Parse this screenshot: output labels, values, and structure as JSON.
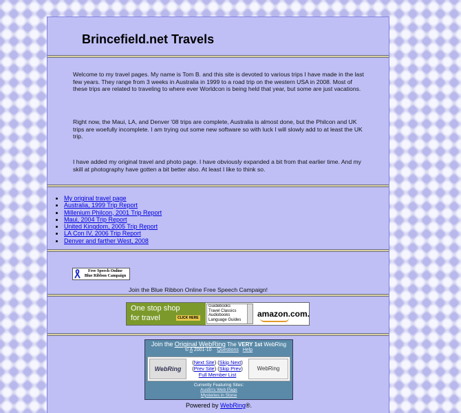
{
  "title": "Brincefield.net Travels",
  "intro": {
    "p1": "Welcome to my travel pages. My name is Tom B. and this site is devoted to various trips I have made in the last few years. They range from 3 weeks in Australia in 1999 to a road trip on the western USA in 2008. Most of these trips are related to traveling to where ever Worldcon is being held that year, but some are just vacations.",
    "p2": "Right now, the Maui, LA, and Denver '08 trips are complete, Australia is almost done, but the Philcon and UK trips are woefully incomplete. I am trying out some new software so with luck I will slowly add to at least the UK trip.",
    "p3": "I have added my original travel and photo page. I have obviously expanded a bit from that earlier time. And my skill at photography have gotten a bit better also. At least I like to think so."
  },
  "links": [
    "My original travel page",
    "Australia, 1999 Trip Report",
    "Millenium Philcon, 2001 Trip Report",
    "Maui, 2004 Trip Report",
    "United Kingdom, 2005 Trip Report",
    "LA Con IV, 2006 Trip Report",
    "Denver and farther West, 2008"
  ],
  "ribbon": {
    "badge_line1": "Free Speech Online",
    "badge_line2": "Blue Ribbon Campaign",
    "caption": "Join the Blue Ribbon Online Free Speech Campaign!"
  },
  "amazon": {
    "promo_line1": "One stop shop",
    "promo_line2": "for travel",
    "click": "CLICK HERE",
    "options": [
      "Guidebooks",
      "Travel Classics",
      "Audiobooks",
      "Language Guides"
    ],
    "logo": "amazon.com."
  },
  "webring": {
    "join": "Join the",
    "ring_name": "Original WebRing",
    "the": "The",
    "very": "VERY 1st",
    "tail": "WebRing",
    "copyright": "© ",
    "copyright_link": "A",
    "copyright_years": " 2001-10",
    "questions": "Questions",
    "help": "Help",
    "logo_left": "WebRing",
    "next_site": "Next Site",
    "skip_next": "Skip Next",
    "prev_site": "Prev Site",
    "skip_prev": "Skip Prev",
    "full_list": "Full Member List",
    "logo_right": "WebRing",
    "featured_label": "Currently Featuring Sites:",
    "featured": [
      "Austin's Web Page",
      "Mysteries in Stone"
    ]
  },
  "powered": {
    "prefix": "Powered by ",
    "link": "WebRing",
    "suffix": "®."
  },
  "colors": {
    "panel": "#bfbff6",
    "link": "#0000dd",
    "webring_bg": "#5a8aa8",
    "amazon_green": "#7c9a2c"
  }
}
